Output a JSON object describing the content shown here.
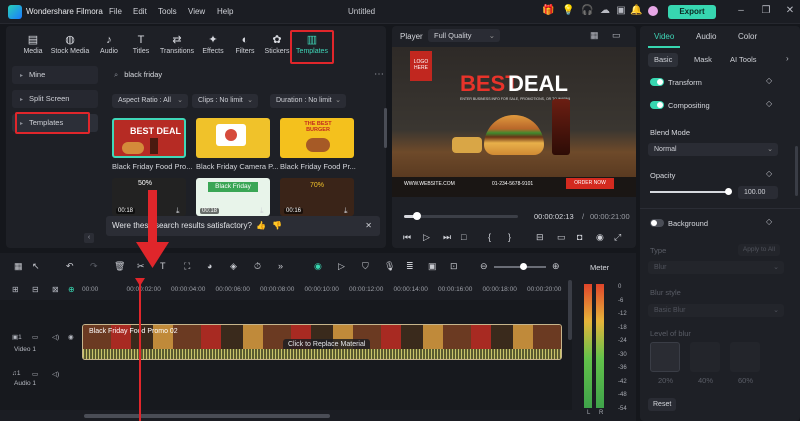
{
  "titlebar": {
    "app_name": "Wondershare Filmora",
    "menu": [
      "File",
      "Edit",
      "Tools",
      "View",
      "Help"
    ],
    "doc_title": "Untitled",
    "export_label": "Export"
  },
  "library": {
    "tabs": [
      {
        "label": "Media",
        "icon": "media-icon"
      },
      {
        "label": "Stock Media",
        "icon": "stock-media-icon"
      },
      {
        "label": "Audio",
        "icon": "audio-icon"
      },
      {
        "label": "Titles",
        "icon": "titles-icon"
      },
      {
        "label": "Transitions",
        "icon": "transitions-icon"
      },
      {
        "label": "Effects",
        "icon": "effects-icon"
      },
      {
        "label": "Filters",
        "icon": "filters-icon"
      },
      {
        "label": "Stickers",
        "icon": "stickers-icon"
      },
      {
        "label": "Templates",
        "icon": "templates-icon"
      }
    ],
    "active_tab": "Templates",
    "sidebar": [
      {
        "label": "Mine"
      },
      {
        "label": "Split Screen"
      },
      {
        "label": "Templates"
      }
    ],
    "search_value": "black friday",
    "filters": [
      "Aspect Ratio : All",
      "Clips : No limit",
      "Duration : No limit"
    ],
    "templates": [
      {
        "name": "Black Friday Food Pro...",
        "thumb_text": "BEST DEAL",
        "bg": "#b62b24"
      },
      {
        "name": "Black Friday Camera P...",
        "thumb_text": "",
        "bg": "#f0c22a"
      },
      {
        "name": "Black Friday Food Pr...",
        "thumb_text": "THE BEST BURGER",
        "bg": "#f4c11d"
      }
    ],
    "row2": [
      {
        "duration": "00:18",
        "thumb_text": "50%",
        "bg": "#222"
      },
      {
        "duration": "00:18",
        "thumb_text": "Black Friday",
        "bg": "#3aa655"
      },
      {
        "duration": "00:16",
        "thumb_text": "70%",
        "bg": "#3a2418"
      }
    ],
    "feedback_text": "Were these search results satisfactory?"
  },
  "player": {
    "label": "Player",
    "quality": "Full Quality",
    "preview": {
      "logo_text": "LOGO HERE",
      "headline_1": "BEST",
      "headline_2": "DEAL",
      "sub_text": "ENTER BUSINESS INFO FOR SALE, PROMOTIONS, OR TO WARNING",
      "website": "WWW.WEBSITE.COM",
      "phone": "01-234-5678-9101",
      "cta": "ORDER NOW"
    },
    "current_time": "00:00:02:13",
    "total_time": "00:00:21:00",
    "progress": 0.11
  },
  "properties": {
    "tabs": [
      "Video",
      "Audio",
      "Color"
    ],
    "active_tab": "Video",
    "subtabs": [
      "Basic",
      "Mask",
      "AI Tools"
    ],
    "items": {
      "transform": "Transform",
      "compositing": "Compositing",
      "blend_mode_label": "Blend Mode",
      "blend_mode_value": "Normal",
      "opacity_label": "Opacity",
      "opacity_value": "100.00",
      "background": "Background",
      "type_label": "Type",
      "apply_all": "Apply to All",
      "type_value": "Blur",
      "blur_style_label": "Blur style",
      "blur_style_value": "Basic Blur",
      "blur_level_label": "Level of blur",
      "levels": [
        "20%",
        "40%",
        "60%"
      ],
      "reset": "Reset"
    }
  },
  "timeline": {
    "ruler": [
      "00:00",
      "00:00:02:00",
      "00:00:04:00",
      "00:00:06:00",
      "00:00:08:00",
      "00:00:10:00",
      "00:00:12:00",
      "00:00:14:00",
      "00:00:16:00",
      "00:00:18:00",
      "00:00:20:00"
    ],
    "clip_title": "Black Friday Food Promo 02",
    "replace_text": "Click to Replace Material",
    "video_track": "Video 1",
    "audio_track": "Audio 1",
    "meter_label": "Meter",
    "meter_scale": [
      "0",
      "-6",
      "-12",
      "-18",
      "-24",
      "-30",
      "-36",
      "-42",
      "-48",
      "-54"
    ],
    "meter_channels": [
      "L",
      "R"
    ]
  },
  "colors": {
    "accent": "#37d6b0",
    "annotation": "#e0262b"
  }
}
